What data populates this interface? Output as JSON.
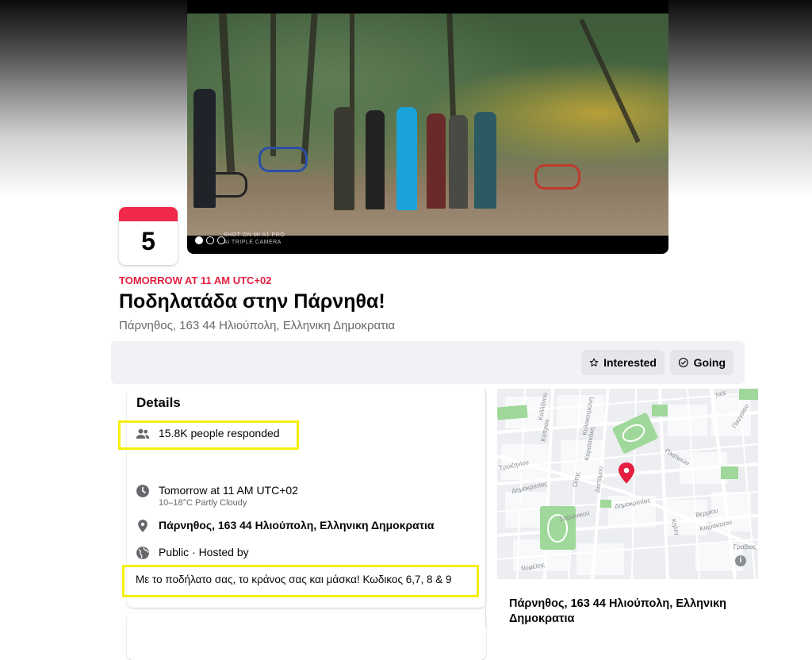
{
  "cover": {
    "watermark_line1": "SHOT ON MI A1 PRO",
    "watermark_line2": "AI TRIPLE CAMERA"
  },
  "date_card": {
    "day": "5"
  },
  "event": {
    "when": "TOMORROW AT 11 AM UTC+02",
    "title": "Ποδηλατάδα στην Πάρνηθα!",
    "location": "Πάρνηθος, 163 44 Ηλιούπολη, Ελληνικη Δημοκρατια"
  },
  "actions": {
    "interested_label": "Interested",
    "going_label": "Going"
  },
  "details": {
    "title": "Details",
    "responded": "15.8K people responded",
    "time": "Tomorrow at 11 AM UTC+02",
    "weather": "10–18°C Partly Cloudy",
    "address": "Πάρνηθος, 163 44 Ηλιούπολη, Ελληνικη Δημοκρατια",
    "privacy": "Public · Hosted by",
    "description": "Με το ποδήλατο σας, το κράνος σας και μάσκα! Κωδικος 6,7, 8 & 9"
  },
  "map": {
    "labels": [
      "Κολλήνου",
      "Κύπρου",
      "Κολοκοτρώνη",
      "Καραϊσκάκη",
      "Τροιζηνίου",
      "Δημοκρατίας",
      "Οίτης",
      "Διστόμου",
      "Σαρωνικού",
      "Δημοκρατίας",
      "Πλαταιών",
      "Βερμίου",
      "Καιμακτσαν",
      "Κηλεγ",
      "Γραβιας",
      "Νεφέλης",
      "Παγγαίου",
      "Λεχ"
    ],
    "info_icon": "i",
    "address": "Πάρνηθος, 163 44 Ηλιούπολη, Ελληνικη Δημοκρατια"
  },
  "colors": {
    "accent_red": "#e41e3f",
    "calendar_band": "#f02849",
    "highlight_yellow": "#f5ee0e",
    "map_pin": "#e41e3f",
    "map_park": "#9fd89a"
  },
  "icons": [
    "star-icon",
    "check-circle-icon",
    "people-icon",
    "clock-icon",
    "location-pin-icon",
    "globe-icon",
    "map-pin-icon",
    "info-icon"
  ]
}
